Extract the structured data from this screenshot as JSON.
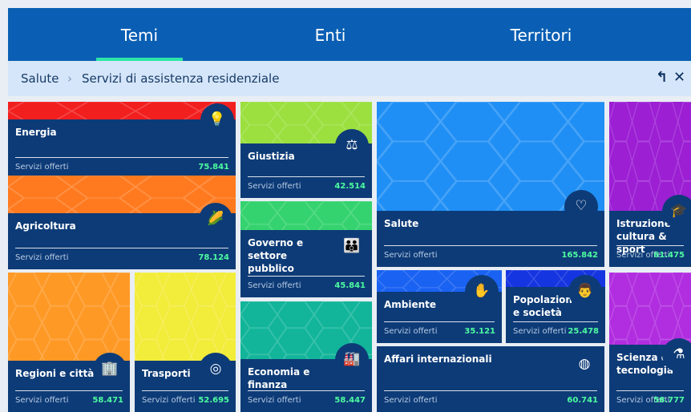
{
  "nav": {
    "tabs": [
      {
        "label": "Temi"
      },
      {
        "label": "Enti"
      },
      {
        "label": "Territori"
      }
    ],
    "active_tab": "Temi"
  },
  "breadcrumb": {
    "items": [
      "Salute",
      "Servizi di assistenza residenziale"
    ],
    "separator": "›",
    "actions": {
      "up_icon": "arrow-up-left-icon",
      "close_icon": "close-icon"
    }
  },
  "colors": {
    "accent": "#2ee6a8",
    "nav_bg": "#0a5fb4",
    "panel_bg": "#0d3b77",
    "value_green": "#4dfca0"
  },
  "meta_label": "Servizi offerti",
  "tiles": [
    {
      "id": "energia",
      "title": "Energia",
      "value": "75.841",
      "icon": "lightbulb-icon",
      "color": "#f21f1f"
    },
    {
      "id": "agricoltura",
      "title": "Agricoltura",
      "value": "78.124",
      "icon": "corn-icon",
      "color": "#ff7a1f"
    },
    {
      "id": "regioni",
      "title": "Regioni e città",
      "value": "58.471",
      "icon": "buildings-icon",
      "color": "#ff9926"
    },
    {
      "id": "trasporti",
      "title": "Trasporti",
      "value": "52.695",
      "icon": "globe-route-icon",
      "color": "#f2ec3a"
    },
    {
      "id": "giustizia",
      "title": "Giustizia",
      "value": "42.514",
      "icon": "scales-icon",
      "color": "#9be03f"
    },
    {
      "id": "governo",
      "title": "Governo e settore pubblico",
      "value": "45.841",
      "icon": "people-icon",
      "color": "#35d36f"
    },
    {
      "id": "economia",
      "title": "Economia e finanza",
      "value": "58.447",
      "icon": "factory-icon",
      "color": "#12b59a"
    },
    {
      "id": "salute",
      "title": "Salute",
      "value": "165.842",
      "icon": "heart-icon",
      "color": "#1f8ff5"
    },
    {
      "id": "ambiente",
      "title": "Ambiente",
      "value": "35.121",
      "icon": "hand-leaf-icon",
      "color": "#1a62f2"
    },
    {
      "id": "popolazione",
      "title": "Popolazione e società",
      "value": "25.478",
      "icon": "family-icon",
      "color": "#1535e0"
    },
    {
      "id": "affari",
      "title": "Affari internazionali",
      "value": "60.741",
      "icon": "globe-icon",
      "color": "#7a2ad6"
    },
    {
      "id": "istruzione",
      "title": "Istruzione cultura & sport",
      "value": "61.475",
      "icon": "graduation-cap-icon",
      "color": "#9c1fd4"
    },
    {
      "id": "scienza",
      "title": "Scienza e tecnologia",
      "value": "58.777",
      "icon": "flask-icon",
      "color": "#b12ee0"
    }
  ]
}
